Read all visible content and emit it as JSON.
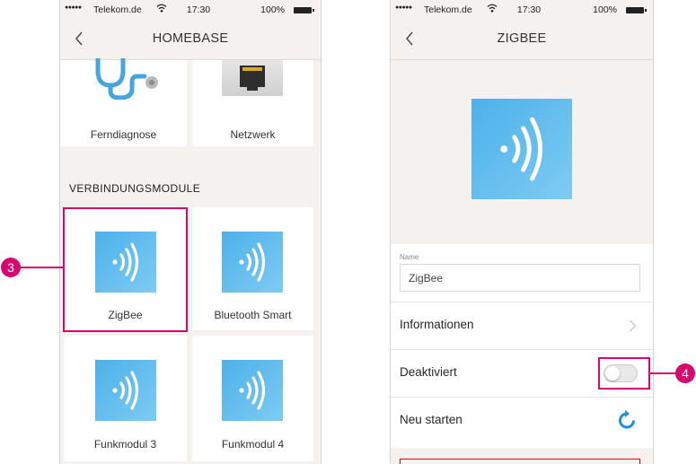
{
  "colors": {
    "accent_magenta": "#d6086d",
    "icon_blue": "#4db1ea",
    "background": "#f5f1ee"
  },
  "left_screen": {
    "statusbar": {
      "carrier": "Telekom.de",
      "time": "17:30",
      "battery": "100%"
    },
    "navbar": {
      "title": "HOMEBASE",
      "back_icon": "chevron-left-icon"
    },
    "top_tiles": [
      {
        "label": "Ferndiagnose",
        "icon": "stethoscope-icon"
      },
      {
        "label": "Netzwerk",
        "icon": "ethernet-port-icon"
      }
    ],
    "section_title": "VERBINDUNGSMODULE",
    "modules": [
      {
        "label": "ZigBee",
        "icon": "wireless-signal-icon",
        "highlighted": true
      },
      {
        "label": "Bluetooth Smart",
        "icon": "wireless-signal-icon"
      },
      {
        "label": "Funkmodul 3",
        "icon": "wireless-signal-icon"
      },
      {
        "label": "Funkmodul 4",
        "icon": "wireless-signal-icon"
      }
    ],
    "callout": "3"
  },
  "right_screen": {
    "statusbar": {
      "carrier": "Telekom.de",
      "time": "17:30",
      "battery": "100%"
    },
    "navbar": {
      "title": "ZIGBEE",
      "back_icon": "chevron-left-icon"
    },
    "hero_icon": "wireless-signal-icon",
    "name_label": "Name",
    "name_value": "ZigBee",
    "rows": {
      "informationen": "Informationen",
      "deaktiviert": "Deaktiviert",
      "deaktiviert_on": false,
      "neu_starten": "Neu starten"
    },
    "callout": "4"
  }
}
